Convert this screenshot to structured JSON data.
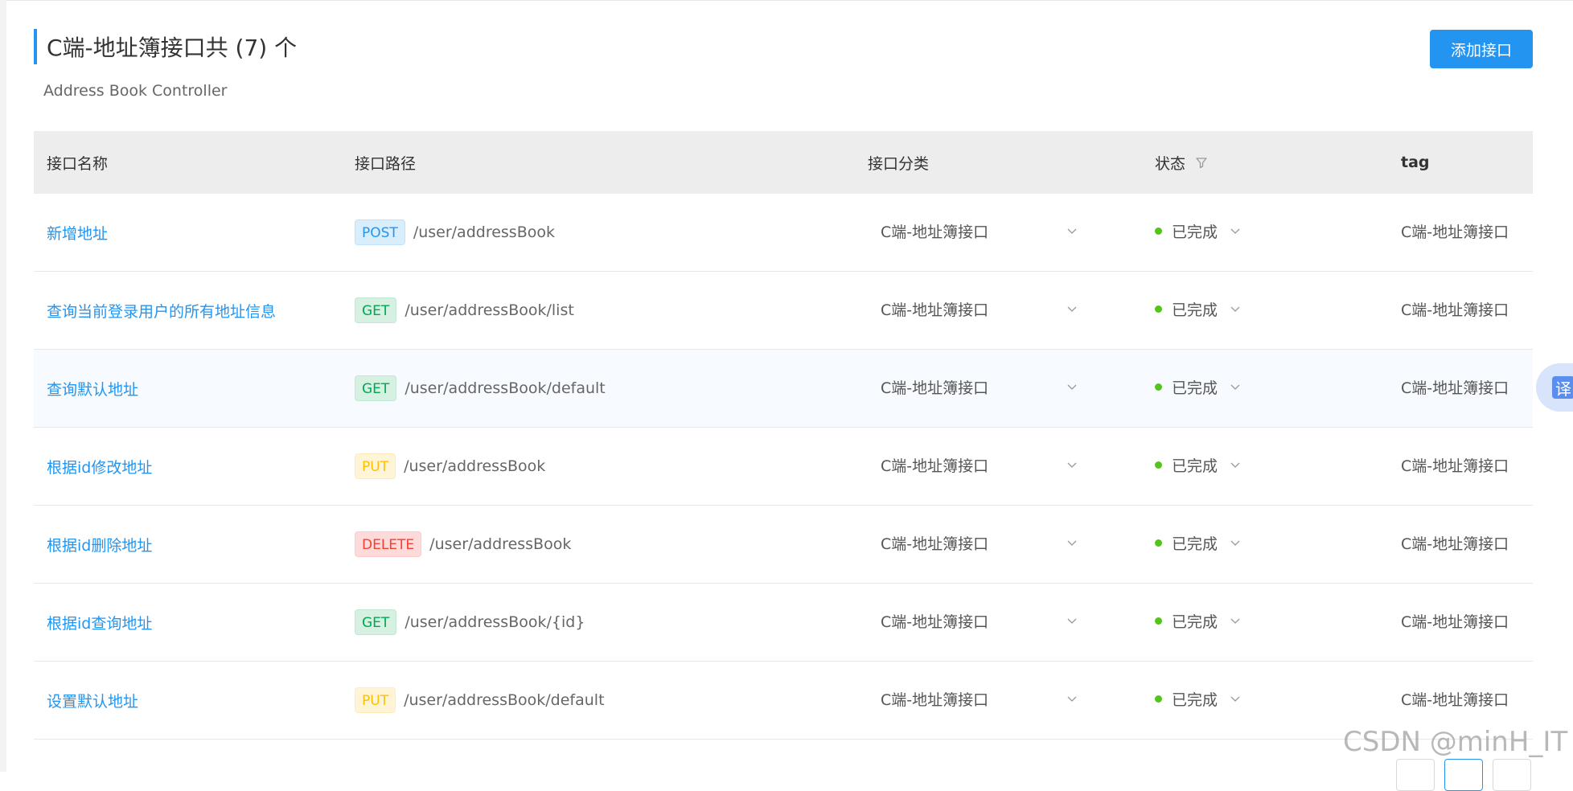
{
  "header": {
    "title": "C端-地址簿接口共 (7) 个",
    "subtitle": "Address Book Controller",
    "add_button": "添加接口"
  },
  "table": {
    "columns": [
      "接口名称",
      "接口路径",
      "接口分类",
      "状态",
      "tag"
    ],
    "rows": [
      {
        "name": "新增地址",
        "method": "POST",
        "path": "/user/addressBook",
        "category": "C端-地址簿接口",
        "status": "已完成",
        "tag": "C端-地址簿接口"
      },
      {
        "name": "查询当前登录用户的所有地址信息",
        "method": "GET",
        "path": "/user/addressBook/list",
        "category": "C端-地址簿接口",
        "status": "已完成",
        "tag": "C端-地址簿接口"
      },
      {
        "name": "查询默认地址",
        "method": "GET",
        "path": "/user/addressBook/default",
        "category": "C端-地址簿接口",
        "status": "已完成",
        "tag": "C端-地址簿接口"
      },
      {
        "name": "根据id修改地址",
        "method": "PUT",
        "path": "/user/addressBook",
        "category": "C端-地址簿接口",
        "status": "已完成",
        "tag": "C端-地址簿接口"
      },
      {
        "name": "根据id删除地址",
        "method": "DELETE",
        "path": "/user/addressBook",
        "category": "C端-地址簿接口",
        "status": "已完成",
        "tag": "C端-地址簿接口"
      },
      {
        "name": "根据id查询地址",
        "method": "GET",
        "path": "/user/addressBook/{id}",
        "category": "C端-地址簿接口",
        "status": "已完成",
        "tag": "C端-地址簿接口"
      },
      {
        "name": "设置默认地址",
        "method": "PUT",
        "path": "/user/addressBook/default",
        "category": "C端-地址簿接口",
        "status": "已完成",
        "tag": "C端-地址簿接口"
      }
    ]
  },
  "translate_button": "译",
  "watermark": "CSDN @minH_IT",
  "colors": {
    "accent": "#2395f1",
    "status_done": "#52c41a",
    "post": "#2395f1",
    "get": "#00a854",
    "put": "#ffbf00",
    "delete": "#f04134"
  },
  "icons": {
    "filter": "filter-icon",
    "chevron": "chevron-down-icon"
  }
}
